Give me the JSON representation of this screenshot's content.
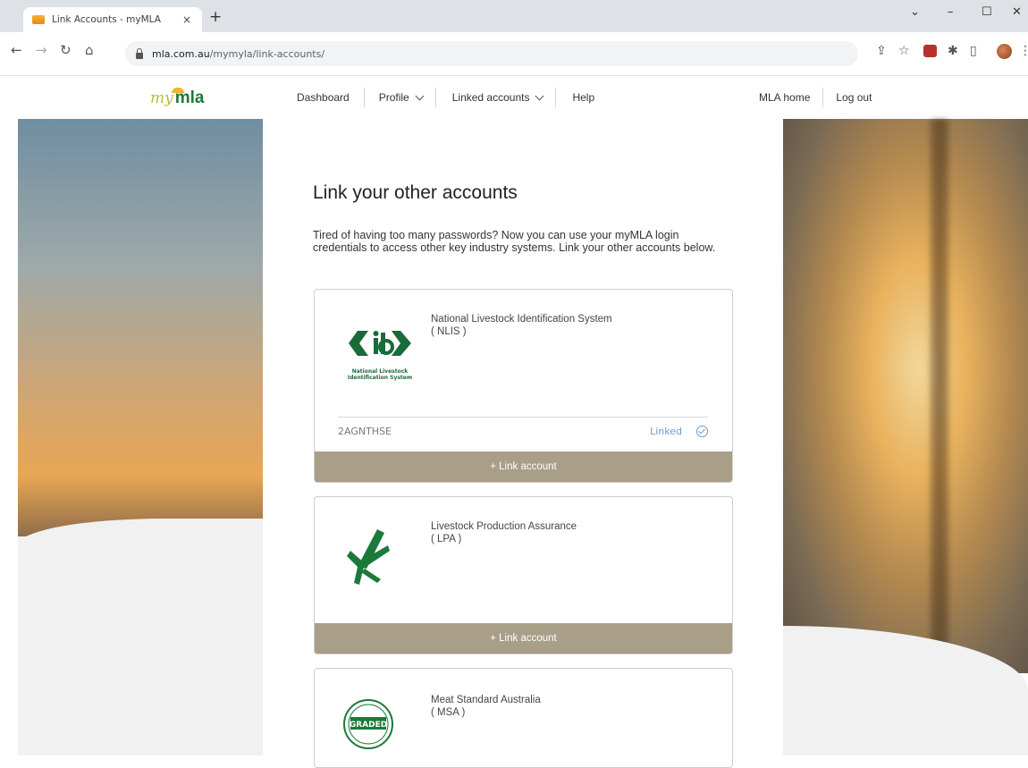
{
  "browser": {
    "tab_title": "Link Accounts - myMLA",
    "tab_close": "×",
    "new_tab": "+",
    "url_host": "mla.com.au",
    "url_path": "/mymyla/link-accounts/"
  },
  "site": {
    "logo_my": "my",
    "logo_mla": "mla",
    "nav": {
      "dashboard": "Dashboard",
      "profile": "Profile",
      "linked_accounts": "Linked accounts",
      "help": "Help",
      "mla_home": "MLA home",
      "logout": "Log out"
    }
  },
  "page": {
    "title": "Link your other accounts",
    "intro": "Tired of having too many passwords? Now you can use your myMLA login credentials to access other key industry systems. Link your other accounts below."
  },
  "cards": [
    {
      "name": "National Livestock Identification System",
      "code": "( NLIS )",
      "logo_caption": "National Livestock Identification System",
      "account_id": "2AGNTHSE",
      "status": "Linked",
      "button": "+ Link account"
    },
    {
      "name": "Livestock Production Assurance",
      "code": "( LPA )",
      "button": "+ Link account"
    },
    {
      "name": "Meat Standard Australia",
      "code": "( MSA )",
      "logo_text": "GRADED"
    }
  ]
}
